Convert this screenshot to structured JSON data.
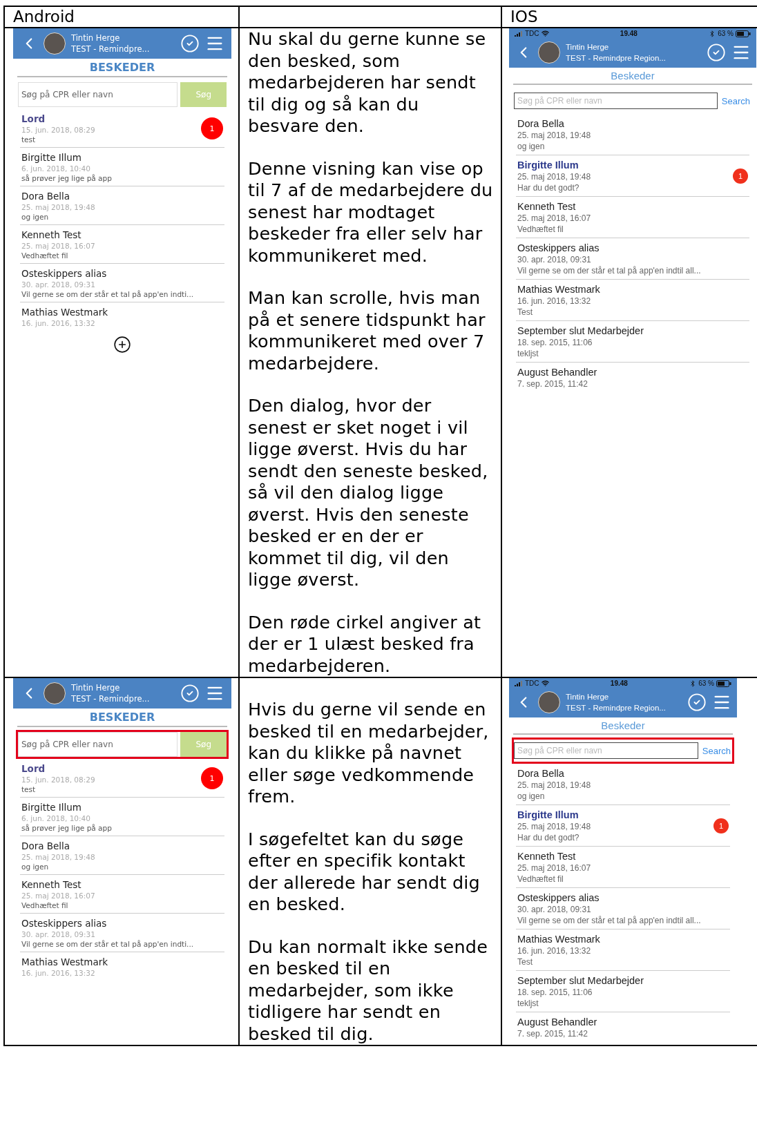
{
  "table": {
    "headers": {
      "column_1": "Android",
      "column_3": "IOS"
    },
    "rows": [
      {
        "android": {
          "kind": "android",
          "header": {
            "name": "Tintin Herge",
            "org": "TEST - Remindpre..."
          },
          "title": "BESKEDER",
          "search": {
            "placeholder": "Søg på CPR eller navn",
            "button": "Søg",
            "highlighted": false
          },
          "messages": [
            {
              "name": "Lord",
              "date": "15. jun. 2018, 08:29",
              "text": "test",
              "unread": true,
              "badge": "1"
            },
            {
              "name": "Birgitte Illum",
              "date": "6. jun. 2018, 10:40",
              "text": "så prøver jeg lige på app",
              "unread": false
            },
            {
              "name": "Dora Bella",
              "date": "25. maj 2018, 19:48",
              "text": "og igen",
              "unread": false
            },
            {
              "name": "Kenneth Test",
              "date": "25. maj 2018, 16:07",
              "text": "Vedhæftet fil",
              "unread": false
            },
            {
              "name": "Osteskippers alias",
              "date": "30. apr. 2018, 09:31",
              "text": "Vil gerne se om der står et tal på app'en indti...",
              "unread": false
            },
            {
              "name": "Mathias Westmark",
              "date": "16. jun. 2016, 13:32",
              "unread": false
            }
          ],
          "add_button": true
        },
        "notes": [
          "Nu skal du gerne kunne se den besked, som medarbejderen har sendt til dig og så kan du besvare den.",
          "Denne visning kan vise op til 7 af de medarbejdere du senest har modtaget beskeder fra eller selv har kommunikeret med.",
          "Man kan scrolle, hvis man på et senere tidspunkt har kommunikeret med over 7 medarbejdere.",
          "Den dialog, hvor der senest er sket noget i vil ligge øverst. Hvis du har sendt den seneste besked, så vil den dialog ligge øverst. Hvis den seneste besked er en der er kommet til dig, vil den ligge øverst.",
          "Den røde cirkel angiver at der er 1 ulæst besked fra medarbejderen."
        ],
        "ios": {
          "kind": "ios",
          "status": {
            "carrier": "TDC",
            "time": "19.48",
            "battery": "63 %"
          },
          "header": {
            "name": "Tintin Herge",
            "org": "TEST - Remindpre Region..."
          },
          "title": "Beskeder",
          "search": {
            "placeholder": "Søg på CPR eller navn",
            "button": "Search",
            "highlighted": false
          },
          "messages": [
            {
              "name": "Dora Bella",
              "date": "25. maj 2018, 19:48",
              "text": "og igen",
              "unread": false
            },
            {
              "name": "Birgitte Illum",
              "date": "25. maj 2018, 19:48",
              "text": "Har du det godt?",
              "unread": true,
              "badge": "1"
            },
            {
              "name": "Kenneth Test",
              "date": "25. maj 2018, 16:07",
              "text": "Vedhæftet fil",
              "unread": false
            },
            {
              "name": "Osteskippers alias",
              "date": "30. apr. 2018, 09:31",
              "text": "Vil gerne se om der står et tal på app'en indtil all...",
              "unread": false
            },
            {
              "name": "Mathias Westmark",
              "date": "16. jun. 2016, 13:32",
              "text": "Test",
              "unread": false
            },
            {
              "name": "September slut Medarbejder",
              "date": "18. sep. 2015, 11:06",
              "text": "tekljst",
              "unread": false
            },
            {
              "name": "August Behandler",
              "date": "7. sep. 2015, 11:42",
              "unread": false
            }
          ]
        }
      },
      {
        "android": {
          "kind": "android",
          "header": {
            "name": "Tintin Herge",
            "org": "TEST - Remindpre..."
          },
          "title": "BESKEDER",
          "search": {
            "placeholder": "Søg på CPR eller navn",
            "button": "Søg",
            "highlighted": true
          },
          "messages": [
            {
              "name": "Lord",
              "date": "15. jun. 2018, 08:29",
              "text": "test",
              "unread": true,
              "badge": "1"
            },
            {
              "name": "Birgitte Illum",
              "date": "6. jun. 2018, 10:40",
              "text": "så prøver jeg lige på app",
              "unread": false
            },
            {
              "name": "Dora Bella",
              "date": "25. maj 2018, 19:48",
              "text": "og igen",
              "unread": false
            },
            {
              "name": "Kenneth Test",
              "date": "25. maj 2018, 16:07",
              "text": "Vedhæftet fil",
              "unread": false
            },
            {
              "name": "Osteskippers alias",
              "date": "30. apr. 2018, 09:31",
              "text": "Vil gerne se om der står et tal på app'en indti...",
              "unread": false
            },
            {
              "name": "Mathias Westmark",
              "date": "16. jun. 2016, 13:32",
              "unread": false
            }
          ],
          "add_button": false
        },
        "notes": [
          "Hvis du gerne vil sende en besked til en medarbejder, kan du klikke på navnet eller søge vedkommende frem.",
          "I søgefeltet kan du søge efter en specifik kontakt der allerede har sendt dig en besked.",
          "Du kan normalt ikke sende en besked til en medarbejder, som ikke tidligere har sendt en besked til dig."
        ],
        "ios": {
          "kind": "ios",
          "status": {
            "carrier": "TDC",
            "time": "19.48",
            "battery": "63 %"
          },
          "header": {
            "name": "Tintin Herge",
            "org": "TEST - Remindpre Region..."
          },
          "title": "Beskeder",
          "search": {
            "placeholder": "Søg på CPR eller navn",
            "button": "Search",
            "highlighted": true
          },
          "messages": [
            {
              "name": "Dora Bella",
              "date": "25. maj 2018, 19:48",
              "text": "og igen",
              "unread": false
            },
            {
              "name": "Birgitte Illum",
              "date": "25. maj 2018, 19:48",
              "text": "Har du det godt?",
              "unread": true,
              "badge": "1"
            },
            {
              "name": "Kenneth Test",
              "date": "25. maj 2018, 16:07",
              "text": "Vedhæftet fil",
              "unread": false
            },
            {
              "name": "Osteskippers alias",
              "date": "30. apr. 2018, 09:31",
              "text": "Vil gerne se om der står et tal på app'en indtil all...",
              "unread": false
            },
            {
              "name": "Mathias Westmark",
              "date": "16. jun. 2016, 13:32",
              "text": "Test",
              "unread": false
            },
            {
              "name": "September slut Medarbejder",
              "date": "18. sep. 2015, 11:06",
              "text": "tekljst",
              "unread": false
            },
            {
              "name": "August Behandler",
              "date": "7. sep. 2015, 11:42",
              "unread": false
            }
          ]
        }
      }
    ]
  }
}
